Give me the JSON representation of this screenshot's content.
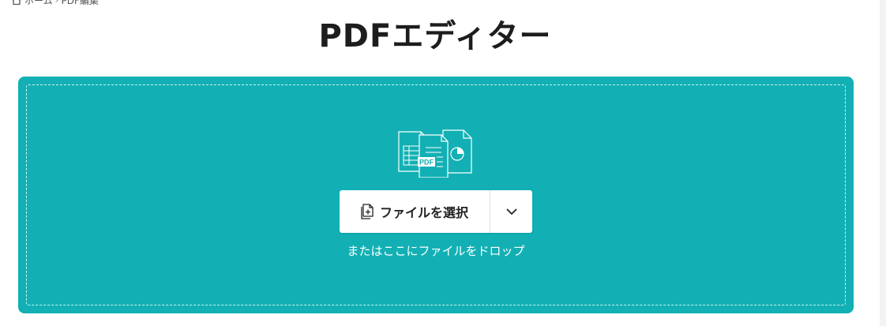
{
  "breadcrumb": {
    "items": [
      "ホーム",
      "PDF編集"
    ],
    "separator": "›"
  },
  "page": {
    "title": "PDFエディター"
  },
  "dropzone": {
    "illustration_icon": "documents-pdf-illustration",
    "illustration_label": "PDF",
    "choose_file_label": "ファイルを選択",
    "choose_file_icon": "add-file-icon",
    "dropdown_icon": "chevron-down-icon",
    "drop_hint": "またはここにファイルをドロップ"
  },
  "colors": {
    "accent": "#12b0b4",
    "title_text": "#1d1d1d",
    "button_background": "#ffffff"
  }
}
